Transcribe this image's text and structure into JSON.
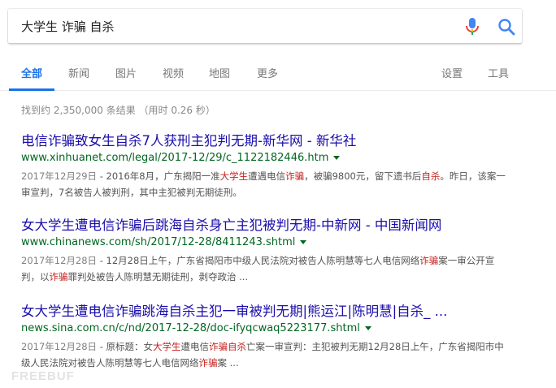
{
  "search": {
    "query": "大学生 诈骗 自杀"
  },
  "tabs": [
    {
      "label": "全部"
    },
    {
      "label": "新闻"
    },
    {
      "label": "图片"
    },
    {
      "label": "视频"
    },
    {
      "label": "地图"
    },
    {
      "label": "更多"
    }
  ],
  "tools": {
    "settings": "设置",
    "tools": "工具"
  },
  "stats": "找到约 2,350,000 条结果 （用时 0.26 秒）",
  "results": [
    {
      "title": "电信诈骗致女生自杀7人获刑主犯判无期-新华网 - 新华社",
      "url": "www.xinhuanet.com/legal/2017-12/29/c_1122182446.htm",
      "date": "2017年12月29日",
      "snippet_a": " - 2016年8月，广东揭阳一准",
      "hl1": "大学生",
      "snippet_b": "遭遇电信",
      "hl2": "诈骗",
      "snippet_c": "，被骗9800元，留下遗书后",
      "hl3": "自杀",
      "snippet_d": "。昨日，该案一审宣判，7名被告人被判刑，其中主犯被判无期徒刑。"
    },
    {
      "title": "女大学生遭电信诈骗后跳海自杀身亡主犯被判无期-中新网 - 中国新闻网",
      "url": "www.chinanews.com/sh/2017/12-28/8411243.shtml",
      "date": "2017年12月28日",
      "snippet_a": " - 12月28日上午，广东省揭阳市中级人民法院对被告人陈明慧等七人电信网络",
      "hl1": "诈骗",
      "snippet_b": "案一审公开宣判，以",
      "hl2": "诈骗",
      "snippet_c": "罪判处被告人陈明慧无期徒刑，剥夺政治 ..."
    },
    {
      "title": "女大学生遭电信诈骗跳海自杀主犯一审被判无期|熊运江|陈明慧|自杀_ ...",
      "url": "news.sina.com.cn/c/nd/2017-12-28/doc-ifyqcwaq5223177.shtml",
      "date": "2017年12月28日",
      "snippet_a": " - 原标题：女",
      "hl1": "大学生",
      "snippet_b": "遭电信",
      "hl2": "诈骗",
      "snippet_c": "自杀",
      "snippet_d": "亡案一审宣判：主犯被判无期12月28日上午，广东省揭阳市中级人民法院对被告人陈明慧等七人电信网络",
      "hl3": "诈骗",
      "snippet_e": "案 ..."
    }
  ],
  "watermark": "FREEBUF",
  "colors": {
    "link": "#1a0dab",
    "url": "#006621",
    "accent": "#1a73e8",
    "highlight": "#c5221f"
  },
  "icons": {
    "mic": "microphone-icon",
    "search": "search-icon"
  }
}
